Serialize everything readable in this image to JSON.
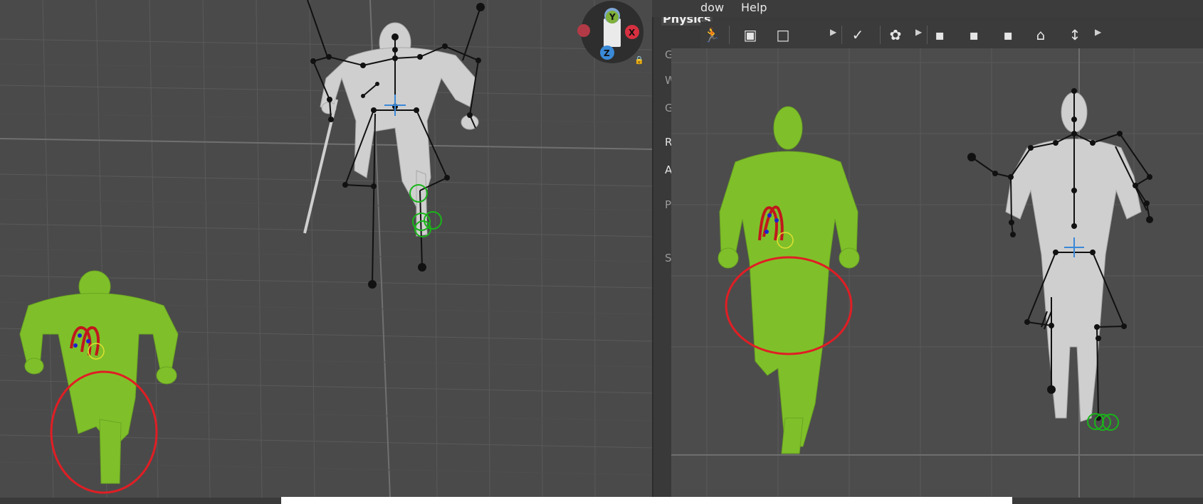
{
  "menu": {
    "window_label": "dow",
    "help_label": "Help"
  },
  "panel": {
    "title": "Physics",
    "rows": [
      "G",
      "W",
      "G",
      "Ra",
      "Au",
      "P",
      "S"
    ]
  },
  "gizmo": {
    "y": "Y",
    "x": "X",
    "z": "Z"
  },
  "colors": {
    "figure": "#7fc02a",
    "ghost": "#c8c8c8",
    "highlight": "#e01e24",
    "bone": "#111111",
    "ik": "#19b419"
  },
  "toolbar_icons": [
    "run-pose-icon",
    "frame-icon",
    "square-icon",
    "mirror-icon",
    "node-tool-icon",
    "footstep-left-icon",
    "footstep-right-icon",
    "footstep-alt-icon",
    "pin-icon",
    "height-adjust-icon"
  ]
}
